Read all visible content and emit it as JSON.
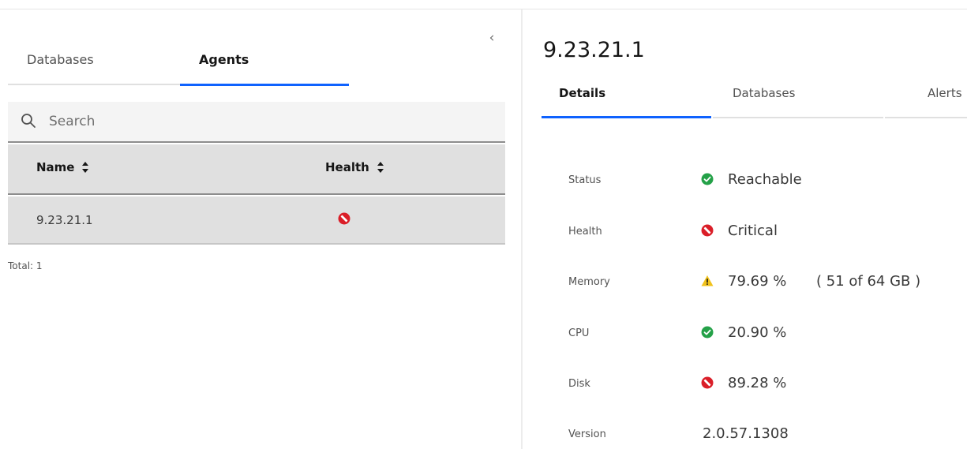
{
  "colors": {
    "accent": "#0f62fe",
    "success": "#24a148",
    "danger": "#da1e28",
    "warning": "#f1c21b"
  },
  "left_panel": {
    "collapse_icon": "chevron-left-icon",
    "tabs": [
      {
        "label": "Databases",
        "active": false
      },
      {
        "label": "Agents",
        "active": true
      }
    ],
    "search": {
      "placeholder": "Search",
      "value": "",
      "icon": "search-icon"
    },
    "table": {
      "columns": [
        {
          "label": "Name",
          "sortable": true
        },
        {
          "label": "Health",
          "sortable": true
        }
      ],
      "rows": [
        {
          "name": "9.23.21.1",
          "health_icon": "critical-icon"
        }
      ]
    },
    "total": "Total: 1"
  },
  "right_panel": {
    "title": "9.23.21.1",
    "tabs": [
      {
        "label": "Details",
        "active": true
      },
      {
        "label": "Databases",
        "active": false
      },
      {
        "label": "Alerts",
        "active": false
      }
    ],
    "properties": [
      {
        "key": "Status",
        "icon": "success-icon",
        "value": "Reachable"
      },
      {
        "key": "Health",
        "icon": "critical-icon",
        "value": "Critical"
      },
      {
        "key": "Memory",
        "icon": "warning-icon",
        "value": "79.69 %",
        "extra": "( 51 of 64 GB )"
      },
      {
        "key": "CPU",
        "icon": "success-icon",
        "value": "20.90 %"
      },
      {
        "key": "Disk",
        "icon": "critical-icon",
        "value": "89.28 %"
      },
      {
        "key": "Version",
        "value": "2.0.57.1308"
      }
    ]
  }
}
